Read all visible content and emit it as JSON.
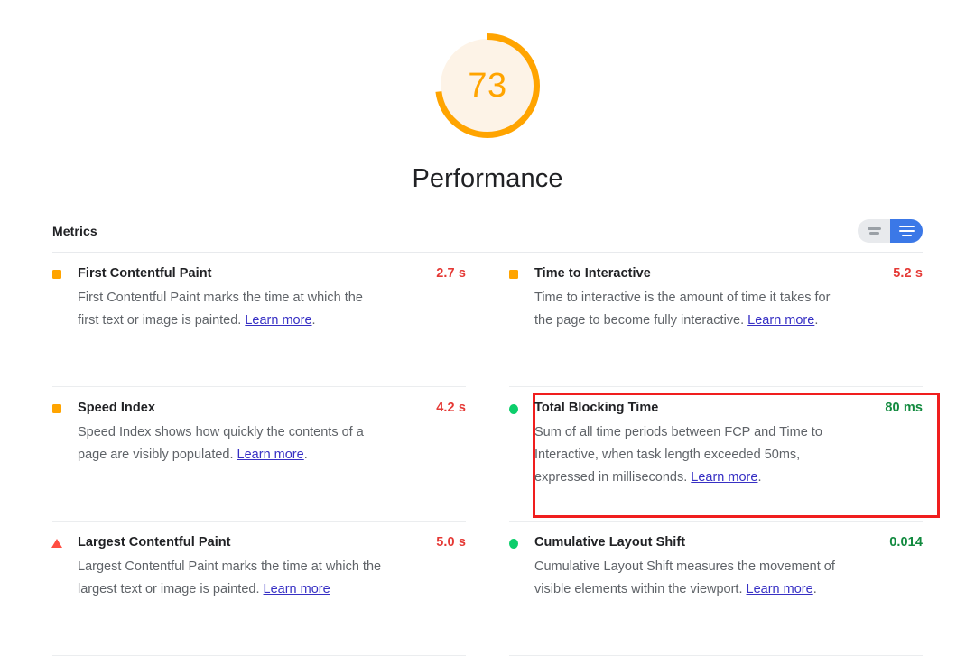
{
  "score": {
    "value": "73",
    "label": "Performance",
    "gauge_percent": 73,
    "gauge_color": "#FFA400",
    "gauge_track_color": "#FDF3E7"
  },
  "metrics_header": {
    "label": "Metrics",
    "toggle": {
      "compact_icon": "compact-view-icon",
      "expanded_icon": "expanded-view-icon",
      "selected": "expanded",
      "selected_color": "#3b78e7",
      "unselected_color": "#e8eaed"
    }
  },
  "metrics": [
    {
      "title": "First Contentful Paint",
      "description": "First Contentful Paint marks the time at which the first text or image is painted. ",
      "link_text": "Learn more",
      "description_tail": ".",
      "value": "2.7 s",
      "value_color": "#e53935",
      "icon": "square-orange-icon",
      "highlighted": false
    },
    {
      "title": "Time to Interactive",
      "description": "Time to interactive is the amount of time it takes for the page to become fully interactive. ",
      "link_text": "Learn more",
      "description_tail": ".",
      "value": "5.2 s",
      "value_color": "#e53935",
      "icon": "square-orange-icon",
      "highlighted": false
    },
    {
      "title": "Speed Index",
      "description": "Speed Index shows how quickly the contents of a page are visibly populated. ",
      "link_text": "Learn more",
      "description_tail": ".",
      "value": "4.2 s",
      "value_color": "#e53935",
      "icon": "square-orange-icon",
      "highlighted": false
    },
    {
      "title": "Total Blocking Time",
      "description": "Sum of all time periods between FCP and Time to Interactive, when task length exceeded 50ms, expressed in milliseconds. ",
      "link_text": "Learn more",
      "description_tail": ".",
      "value": "80 ms",
      "value_color": "#128a3f",
      "icon": "circle-green-icon",
      "highlighted": true,
      "highlight_color": "#f01e1e"
    },
    {
      "title": "Largest Contentful Paint",
      "description": "Largest Contentful Paint marks the time at which the largest text or image is painted. ",
      "link_text": "Learn more",
      "description_tail": "",
      "value": "5.0 s",
      "value_color": "#e53935",
      "icon": "triangle-red-icon",
      "highlighted": false
    },
    {
      "title": "Cumulative Layout Shift",
      "description": "Cumulative Layout Shift measures the movement of visible elements within the viewport. ",
      "link_text": "Learn more",
      "description_tail": ".",
      "value": "0.014",
      "value_color": "#128a3f",
      "icon": "circle-green-icon",
      "highlighted": false
    }
  ]
}
